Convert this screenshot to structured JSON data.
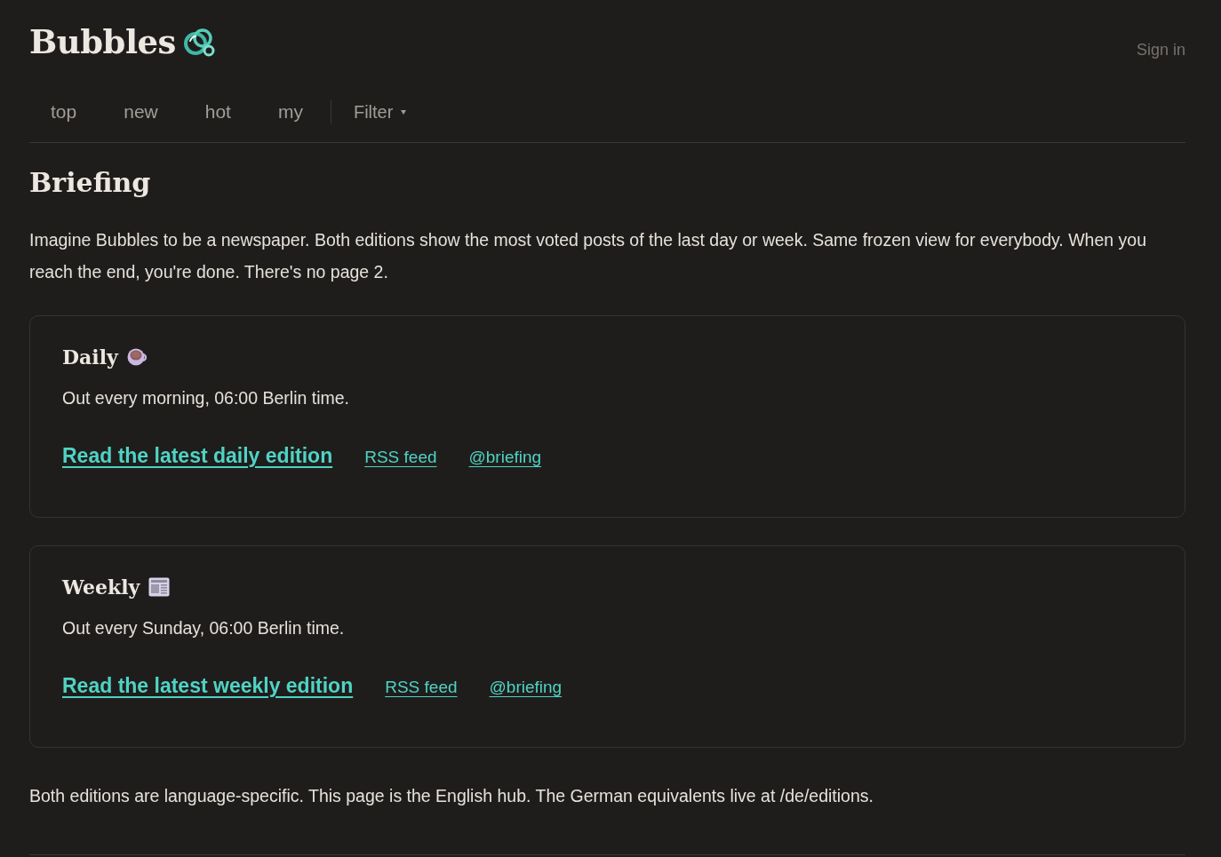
{
  "header": {
    "logo": "Bubbles",
    "sign_in": "Sign in"
  },
  "nav": {
    "items": [
      {
        "label": "top",
        "selected": false
      },
      {
        "label": "new",
        "selected": false
      },
      {
        "label": "hot",
        "selected": false
      },
      {
        "label": "my",
        "selected": false
      }
    ],
    "filter": "Filter"
  },
  "page": {
    "title": "Briefing",
    "intro": "Imagine Bubbles to be a newspaper. Both editions show the most voted posts of the last day or week. Same frozen view for everybody. When you reach the end, you're done. There's no page 2."
  },
  "editions": [
    {
      "kind": "daily",
      "title": "Daily",
      "schedule": "Out every morning, 06:00 Berlin time.",
      "main_link": "Read the latest daily edition",
      "rss_link": "RSS feed",
      "social_link": "@briefing"
    },
    {
      "kind": "weekly",
      "title": "Weekly",
      "schedule": "Out every Sunday, 06:00 Berlin time.",
      "main_link": "Read the latest weekly edition",
      "rss_link": "RSS feed",
      "social_link": "@briefing"
    }
  ],
  "footer": {
    "text": "Both editions are language-specific. This page is the English hub. The German equivalents live at ",
    "link": "/de/editions",
    "end": "."
  }
}
